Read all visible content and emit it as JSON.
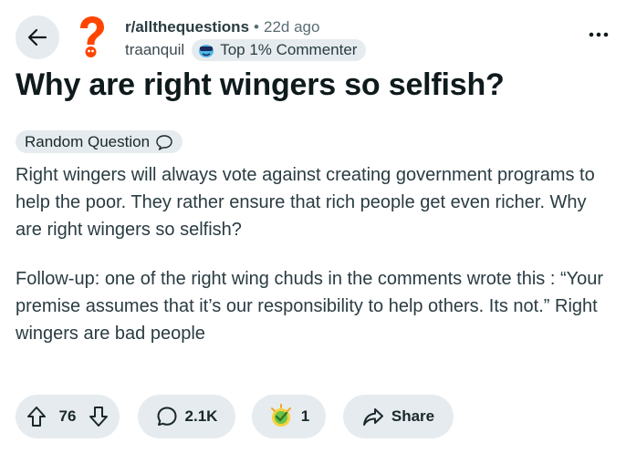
{
  "header": {
    "subreddit": "r/allthequestions",
    "separator": "•",
    "age": "22d ago",
    "author": "traanquil",
    "user_flair": "Top 1% Commenter",
    "back_icon": "arrow-left-icon",
    "more_icon": "ellipsis-icon",
    "subreddit_icon": "question-mark-avatar-icon"
  },
  "post": {
    "title": "Why are right wingers so selfish?",
    "flair": "Random Question",
    "paragraphs": [
      "Right wingers will always vote against creating government programs to help the poor. They rather ensure that rich people get even richer. Why are right wingers so selfish?",
      "Follow-up: one of the right wing chuds in the comments wrote this : “Your premise assumes that it’s our responsibility to help others. Its not.” Right wingers are bad people"
    ]
  },
  "actions": {
    "votes": "76",
    "comments": "2.1K",
    "awards": "1",
    "share": "Share"
  },
  "colors": {
    "pill_bg": "#e5ebee",
    "subreddit_accent": "#ff4500",
    "text": "#0f1a1c"
  }
}
